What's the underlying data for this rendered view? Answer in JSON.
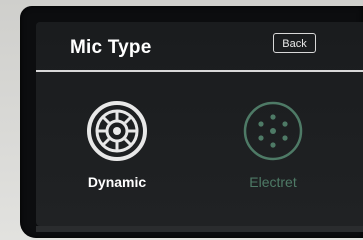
{
  "header": {
    "title": "Mic Type",
    "back_label": "Back"
  },
  "options": [
    {
      "label": "Dynamic",
      "icon": "dynamic-mic-icon",
      "selected": true
    },
    {
      "label": "Electret",
      "icon": "electret-mic-icon",
      "selected": false
    }
  ],
  "colors": {
    "screen_bg": "#1c1e20",
    "text_primary": "#ffffff",
    "text_inactive": "#4e7a66",
    "divider": "#d8d8d8"
  }
}
